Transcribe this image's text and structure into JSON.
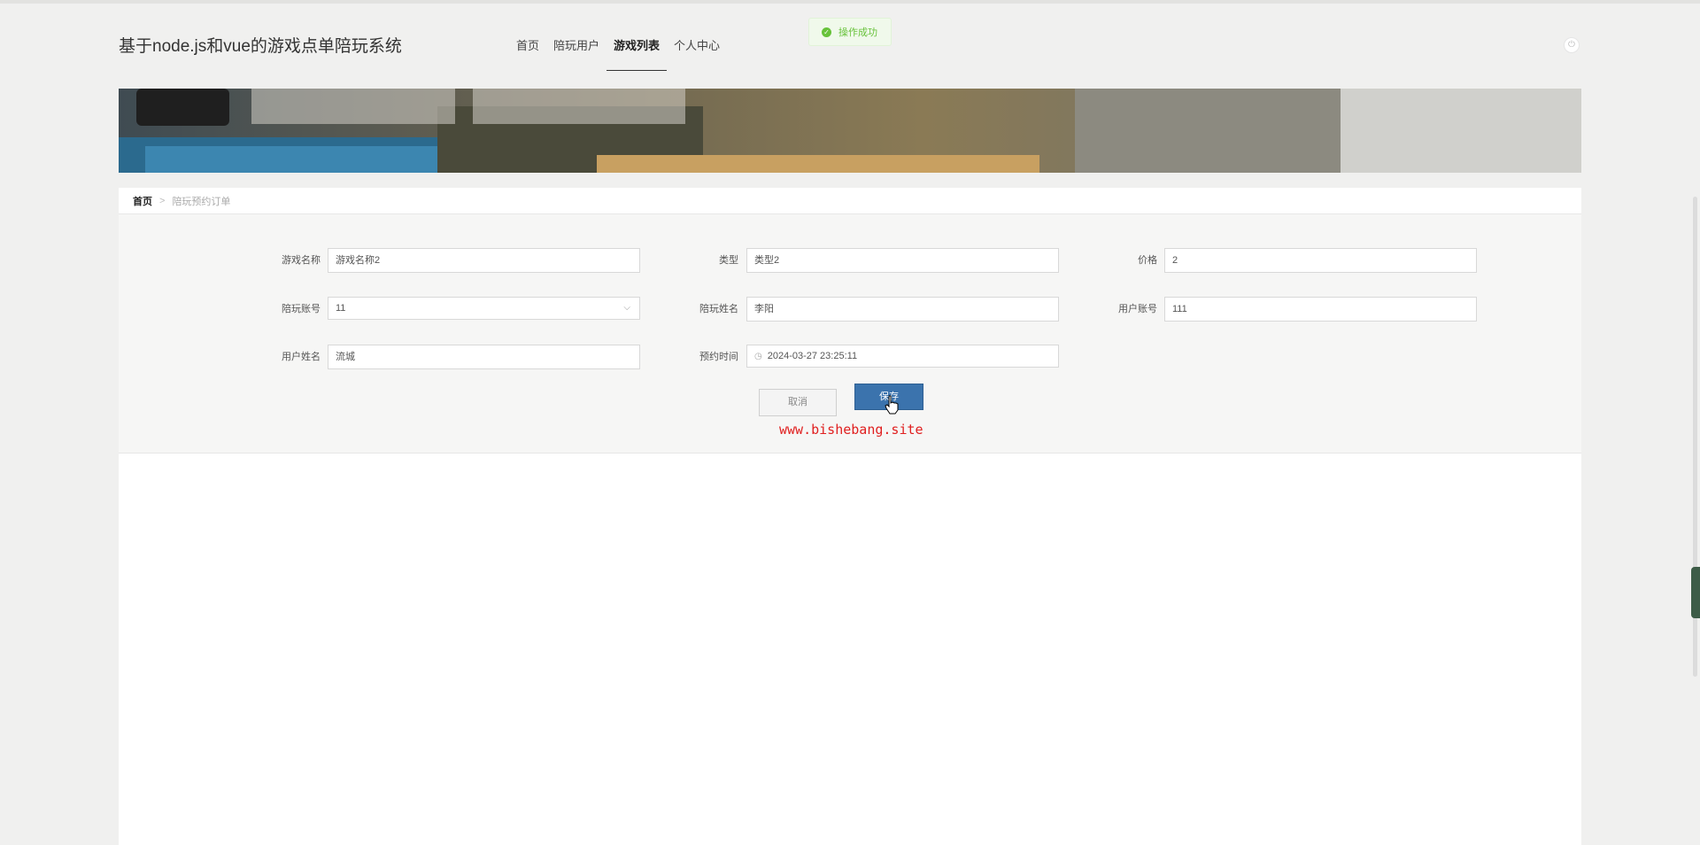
{
  "header": {
    "site_title": "基于node.js和vue的游戏点单陪玩系统",
    "nav": [
      {
        "label": "首页",
        "active": false
      },
      {
        "label": "陪玩用户",
        "active": false
      },
      {
        "label": "游戏列表",
        "active": true
      },
      {
        "label": "个人中心",
        "active": false
      }
    ],
    "power_icon": "power-icon"
  },
  "toast": {
    "message": "操作成功",
    "icon": "check-circle-icon",
    "color": "#67c23a"
  },
  "breadcrumb": {
    "home": "首页",
    "separator": ">",
    "current": "陪玩预约订单"
  },
  "form": {
    "game_name": {
      "label": "游戏名称",
      "value": "游戏名称2"
    },
    "type": {
      "label": "类型",
      "value": "类型2"
    },
    "price": {
      "label": "价格",
      "value": "2"
    },
    "companion_account": {
      "label": "陪玩账号",
      "value": "11"
    },
    "companion_name": {
      "label": "陪玩姓名",
      "value": "李阳"
    },
    "user_account": {
      "label": "用户账号",
      "value": "111"
    },
    "user_name": {
      "label": "用户姓名",
      "value": "流城"
    },
    "booking_time": {
      "label": "预约时间",
      "value": "2024-03-27 23:25:11"
    }
  },
  "buttons": {
    "cancel": "取消",
    "save": "保存"
  },
  "watermark": "www.bishebang.site",
  "colors": {
    "primary": "#3b73ad",
    "success": "#67c23a",
    "watermark": "#e02020"
  }
}
